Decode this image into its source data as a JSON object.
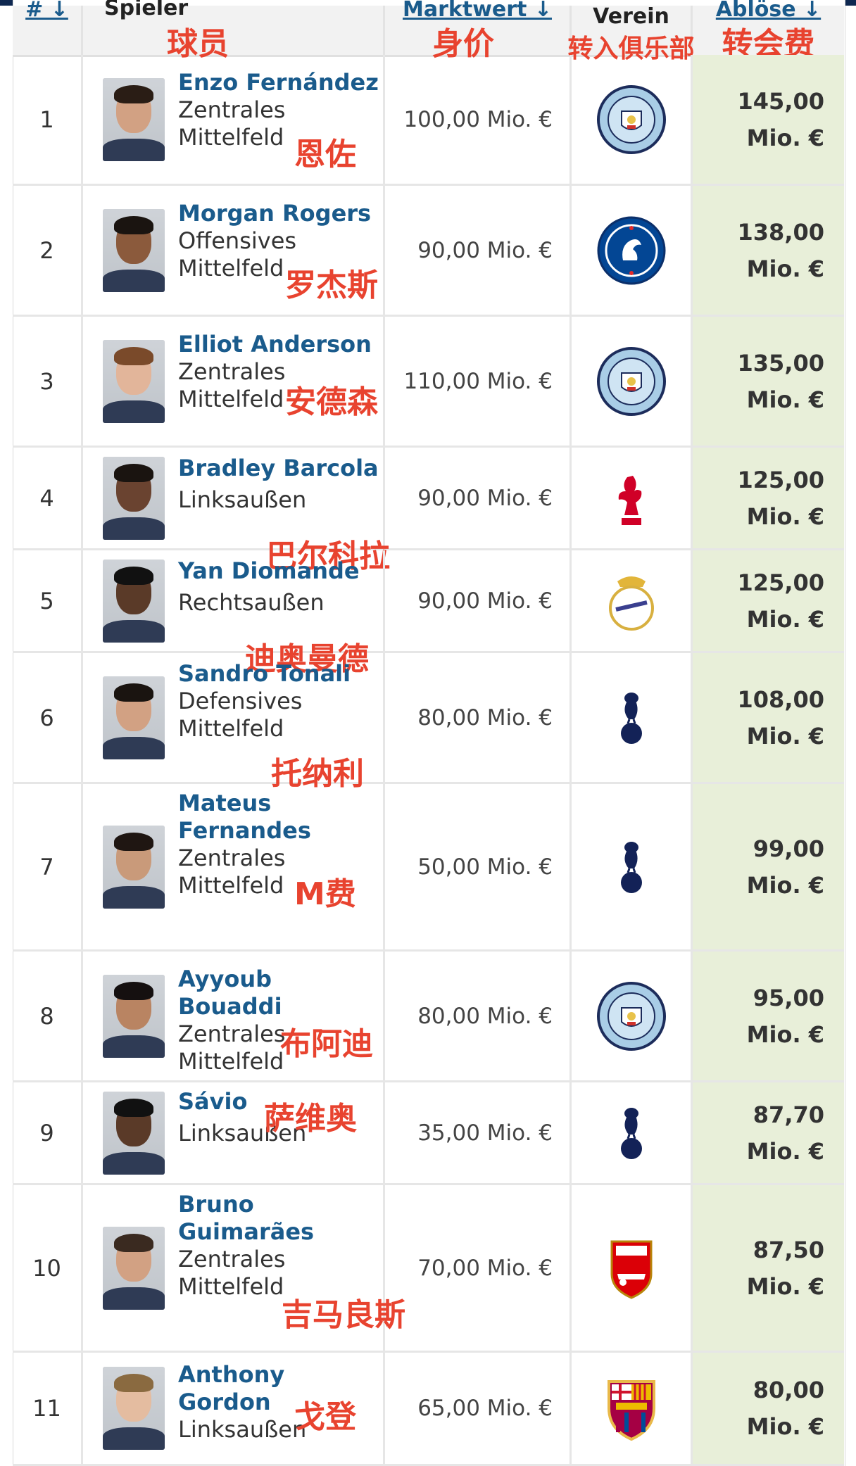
{
  "header": {
    "col_rank": "# ↓",
    "col_player_de": "Spieler",
    "col_player_zh": "球员",
    "col_mv_de": "Marktwert ↓",
    "col_mv_zh": "身价",
    "col_club_de": "Verein",
    "col_club_zh": "转入俱乐部",
    "col_fee_de": "Ablöse ↓",
    "col_fee_zh": "转会费"
  },
  "rows": [
    {
      "rank": "1",
      "name_lines": [
        "Enzo Fernández"
      ],
      "pos_lines": [
        "Zentrales",
        "Mittelfeld"
      ],
      "zh": "恩佐",
      "market_value": "100,00 Mio. €",
      "club": "manchester-city",
      "fee_amount": "145,00",
      "fee_unit": "Mio. €"
    },
    {
      "rank": "2",
      "name_lines": [
        "Morgan Rogers"
      ],
      "pos_lines": [
        "Offensives",
        "Mittelfeld"
      ],
      "zh": "罗杰斯",
      "market_value": "90,00 Mio. €",
      "club": "chelsea",
      "fee_amount": "138,00",
      "fee_unit": "Mio. €"
    },
    {
      "rank": "3",
      "name_lines": [
        "Elliot Anderson"
      ],
      "pos_lines": [
        "Zentrales",
        "Mittelfeld"
      ],
      "zh": "安德森",
      "market_value": "110,00 Mio. €",
      "club": "manchester-city",
      "fee_amount": "135,00",
      "fee_unit": "Mio. €"
    },
    {
      "rank": "4",
      "name_lines": [
        "Bradley Barcola"
      ],
      "pos_lines": [
        "Linksaußen"
      ],
      "zh": "巴尔科拉",
      "market_value": "90,00 Mio. €",
      "club": "liverpool",
      "fee_amount": "125,00",
      "fee_unit": "Mio. €"
    },
    {
      "rank": "5",
      "name_lines": [
        "Yan Diomande"
      ],
      "pos_lines": [
        "Rechtsaußen"
      ],
      "zh": "迪奥曼德",
      "market_value": "90,00 Mio. €",
      "club": "real-madrid",
      "fee_amount": "125,00",
      "fee_unit": "Mio. €"
    },
    {
      "rank": "6",
      "name_lines": [
        "Sandro Tonali"
      ],
      "pos_lines": [
        "Defensives",
        "Mittelfeld"
      ],
      "zh": "托纳利",
      "market_value": "80,00 Mio. €",
      "club": "tottenham",
      "fee_amount": "108,00",
      "fee_unit": "Mio. €"
    },
    {
      "rank": "7",
      "name_lines": [
        "Mateus",
        "Fernandes"
      ],
      "pos_lines": [
        "Zentrales",
        "Mittelfeld"
      ],
      "zh": "M费",
      "market_value": "50,00 Mio. €",
      "club": "tottenham",
      "fee_amount": "99,00",
      "fee_unit": "Mio. €"
    },
    {
      "rank": "8",
      "name_lines": [
        "Ayyoub Bouaddi"
      ],
      "pos_lines": [
        "Zentrales",
        "Mittelfeld"
      ],
      "zh": "布阿迪",
      "market_value": "80,00 Mio. €",
      "club": "manchester-city",
      "fee_amount": "95,00",
      "fee_unit": "Mio. €"
    },
    {
      "rank": "9",
      "name_lines": [
        "Sávio"
      ],
      "pos_lines": [
        "Linksaußen"
      ],
      "zh": "萨维奥",
      "market_value": "35,00 Mio. €",
      "club": "tottenham",
      "fee_amount": "87,70",
      "fee_unit": "Mio. €"
    },
    {
      "rank": "10",
      "name_lines": [
        "Bruno",
        "Guimarães"
      ],
      "pos_lines": [
        "Zentrales",
        "Mittelfeld"
      ],
      "zh": "吉马良斯",
      "market_value": "70,00 Mio. €",
      "club": "arsenal",
      "fee_amount": "87,50",
      "fee_unit": "Mio. €"
    },
    {
      "rank": "11",
      "name_lines": [
        "Anthony",
        "Gordon"
      ],
      "pos_lines": [
        "Linksaußen"
      ],
      "zh": "戈登",
      "market_value": "65,00 Mio. €",
      "club": "barcelona",
      "fee_amount": "80,00",
      "fee_unit": "Mio. €"
    }
  ],
  "colors": {
    "link": "#1a5b8c",
    "annotation": "#e8432f",
    "fee_bg": "#e8efd9",
    "topbar": "#0e2750"
  }
}
